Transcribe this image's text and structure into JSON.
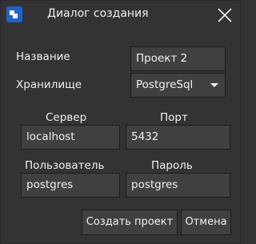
{
  "window": {
    "title": "Диалог создания",
    "app_icon": "app-logo-icon",
    "close_icon": "close-icon"
  },
  "form": {
    "name_label": "Название",
    "name_value": "Проект 2",
    "storage_label": "Хранилище",
    "storage_value": "PostgreSql",
    "server_label": "Сервер",
    "server_value": "localhost",
    "port_label": "Порт",
    "port_value": "5432",
    "user_label": "Пользователь",
    "user_value": "postgres",
    "password_label": "Пароль",
    "password_value": "postgres"
  },
  "buttons": {
    "create_label": "Создать проект",
    "cancel_label": "Отмена"
  },
  "colors": {
    "background": "#333333",
    "field": "#404040",
    "border": "#1c1c1c",
    "text": "#f0f0f0",
    "accent": "#1f63c9"
  }
}
